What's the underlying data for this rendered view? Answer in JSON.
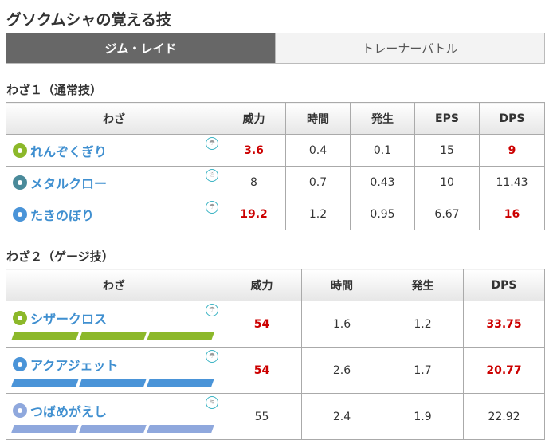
{
  "title": "グソクムシャの覚える技",
  "tabs": [
    {
      "label": "ジム・レイド",
      "active": true
    },
    {
      "label": "トレーナーバトル",
      "active": false
    }
  ],
  "fast": {
    "heading": "わざ１（通常技）",
    "headers": [
      "わざ",
      "威力",
      "時間",
      "発生",
      "EPS",
      "DPS"
    ],
    "rows": [
      {
        "name": "れんぞくぎり",
        "type_color": "#8cb82a",
        "weather_icon": "umbrella-icon",
        "power": "3.6",
        "time": "0.4",
        "onset": "0.1",
        "eps": "15",
        "dps": "9",
        "highlight": true
      },
      {
        "name": "メタルクロー",
        "type_color": "#4a8a9a",
        "weather_icon": "snowman-icon",
        "power": "8",
        "time": "0.7",
        "onset": "0.43",
        "eps": "10",
        "dps": "11.43",
        "highlight": false
      },
      {
        "name": "たきのぼり",
        "type_color": "#4a94d8",
        "weather_icon": "umbrella-icon",
        "power": "19.2",
        "time": "1.2",
        "onset": "0.95",
        "eps": "6.67",
        "dps": "16",
        "highlight": true
      }
    ]
  },
  "charged": {
    "heading": "わざ２（ゲージ技）",
    "headers": [
      "わざ",
      "威力",
      "時間",
      "発生",
      "DPS"
    ],
    "rows": [
      {
        "name": "シザークロス",
        "type_color": "#8cb82a",
        "weather_icon": "umbrella-icon",
        "bars": 3,
        "power": "54",
        "time": "1.6",
        "onset": "1.2",
        "dps": "33.75",
        "highlight": true
      },
      {
        "name": "アクアジェット",
        "type_color": "#4a94d8",
        "weather_icon": "umbrella-icon",
        "bars": 3,
        "power": "54",
        "time": "2.6",
        "onset": "1.7",
        "dps": "20.77",
        "highlight": true
      },
      {
        "name": "つばめがえし",
        "type_color": "#8fa8dd",
        "weather_icon": "wind-icon",
        "bars": 3,
        "power": "55",
        "time": "2.4",
        "onset": "1.9",
        "dps": "22.92",
        "highlight": false
      }
    ]
  }
}
